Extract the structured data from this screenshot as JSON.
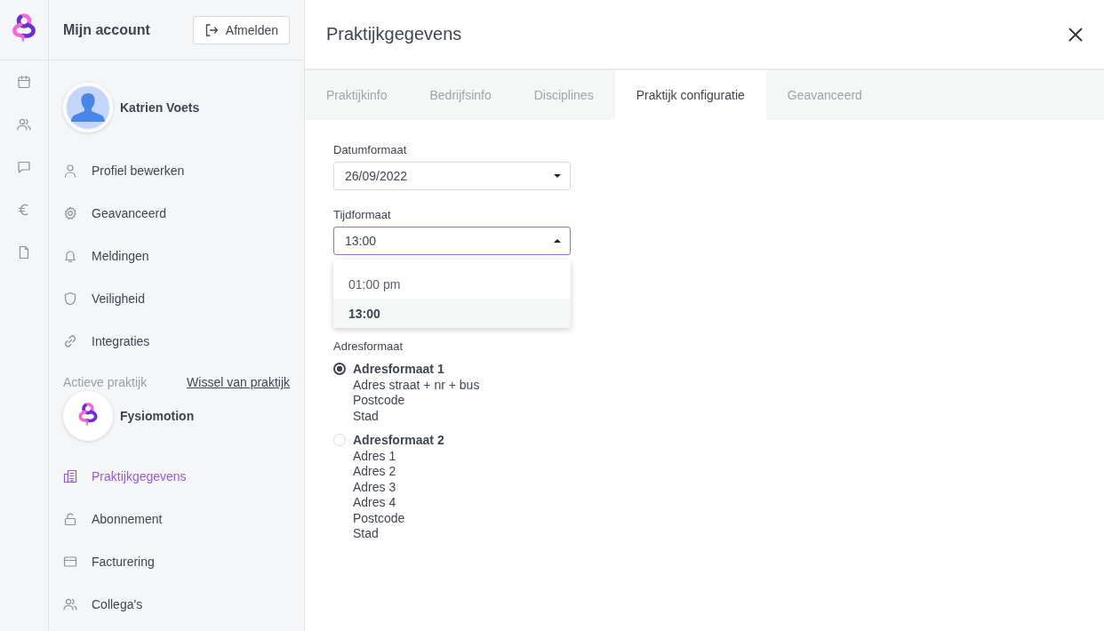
{
  "sidebar": {
    "title": "Mijn account",
    "logout_button": "Afmelden",
    "user_name": "Katrien Voets",
    "account_items": [
      {
        "label": "Profiel bewerken",
        "selected": false
      },
      {
        "label": "Geavanceerd",
        "selected": false
      },
      {
        "label": "Meldingen",
        "selected": false
      },
      {
        "label": "Veiligheid",
        "selected": false
      },
      {
        "label": "Integraties",
        "selected": false
      }
    ],
    "practice_label": "Actieve praktijk",
    "switch_link": "Wissel van praktijk",
    "practice_name": "Fysiomotion",
    "practice_items": [
      {
        "label": "Praktijkgegevens",
        "selected": true
      },
      {
        "label": "Abonnement",
        "selected": false
      },
      {
        "label": "Facturering",
        "selected": false
      },
      {
        "label": "Collega's",
        "selected": false
      }
    ]
  },
  "panel": {
    "title": "Praktijkgegevens",
    "tabs": [
      {
        "label": "Praktijkinfo",
        "selected": false
      },
      {
        "label": "Bedrijfsinfo",
        "selected": false
      },
      {
        "label": "Disciplines",
        "selected": false
      },
      {
        "label": "Praktijk configuratie",
        "selected": true
      },
      {
        "label": "Geavanceerd",
        "selected": false
      }
    ],
    "date_format": {
      "label": "Datumformaat",
      "value": "26/09/2022",
      "expanded": false
    },
    "time_format": {
      "label": "Tijdformaat",
      "value": "13:00",
      "expanded": true,
      "options": [
        {
          "label": "01:00 pm",
          "selected": false
        },
        {
          "label": "13:00",
          "selected": true
        }
      ]
    },
    "address_format": {
      "label": "Adresformaat",
      "options": [
        {
          "title": "Adresformaat 1",
          "lines": [
            "Adres straat + nr + bus",
            "Postcode",
            "Stad"
          ],
          "selected": true
        },
        {
          "title": "Adresformaat 2",
          "lines": [
            "Adres 1",
            "Adres 2",
            "Adres 3",
            "Adres 4",
            "Postcode",
            "Stad"
          ],
          "selected": false
        }
      ]
    }
  }
}
